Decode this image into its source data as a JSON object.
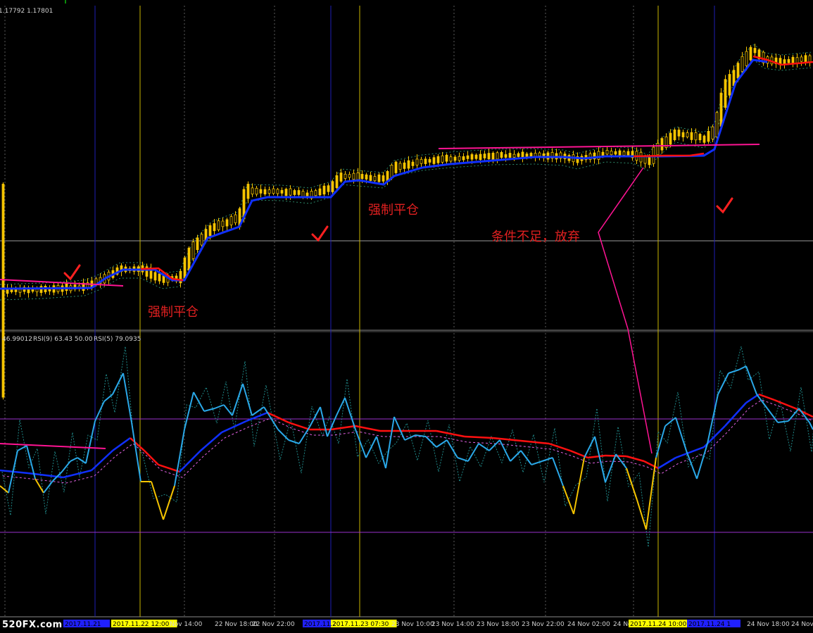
{
  "price_panel": {
    "price_readout": "1.17792 1.17801"
  },
  "rsi_panel": {
    "readout_value": "46.99012",
    "rsi9_label": "RSI(9) 63.43 50.00",
    "rsi5_label": "RSI(5) 79.0935"
  },
  "annotations": {
    "forced_close_1": "强制平仓",
    "forced_close_2": "强制平仓",
    "insufficient": "条件不足，放弃",
    "checkmark": "✓"
  },
  "time_axis": {
    "labels": [
      {
        "text": "2017.11.22 12:00",
        "highlight": "yellow"
      },
      {
        "text": "Nov 14:00"
      },
      {
        "text": "22 Nov 18:00"
      },
      {
        "text": "22 Nov 22:00"
      },
      {
        "text": "2017.11.23 07:30",
        "highlight": "yellow"
      },
      {
        "text": "23 Nov 10:00"
      },
      {
        "text": "23 Nov 14:00"
      },
      {
        "text": "23 Nov 18:00"
      },
      {
        "text": "23 Nov 22:00"
      },
      {
        "text": "24 Nov 02:00"
      },
      {
        "text": "24 No"
      },
      {
        "text": "2017.11.24 10:00",
        "highlight": "yellow"
      },
      {
        "text": "24 Nov 18:00"
      },
      {
        "text": "24 Nov"
      }
    ],
    "blue_markers": [
      "2017.11.21",
      "2017.11.2",
      "2017.11.24 1"
    ]
  },
  "watermark": "520FX.com",
  "colors": {
    "background": "#000000",
    "candle_bull": "#f5c400",
    "grid": "#808080",
    "blue_line": "#1030ff",
    "red_line": "#ff1010",
    "magenta": "#ff1493",
    "cyan": "#2aa8e8",
    "purple_level": "#9a32cd",
    "vline_blue": "#1e1eb4",
    "vline_yellow": "#c8b400"
  }
}
